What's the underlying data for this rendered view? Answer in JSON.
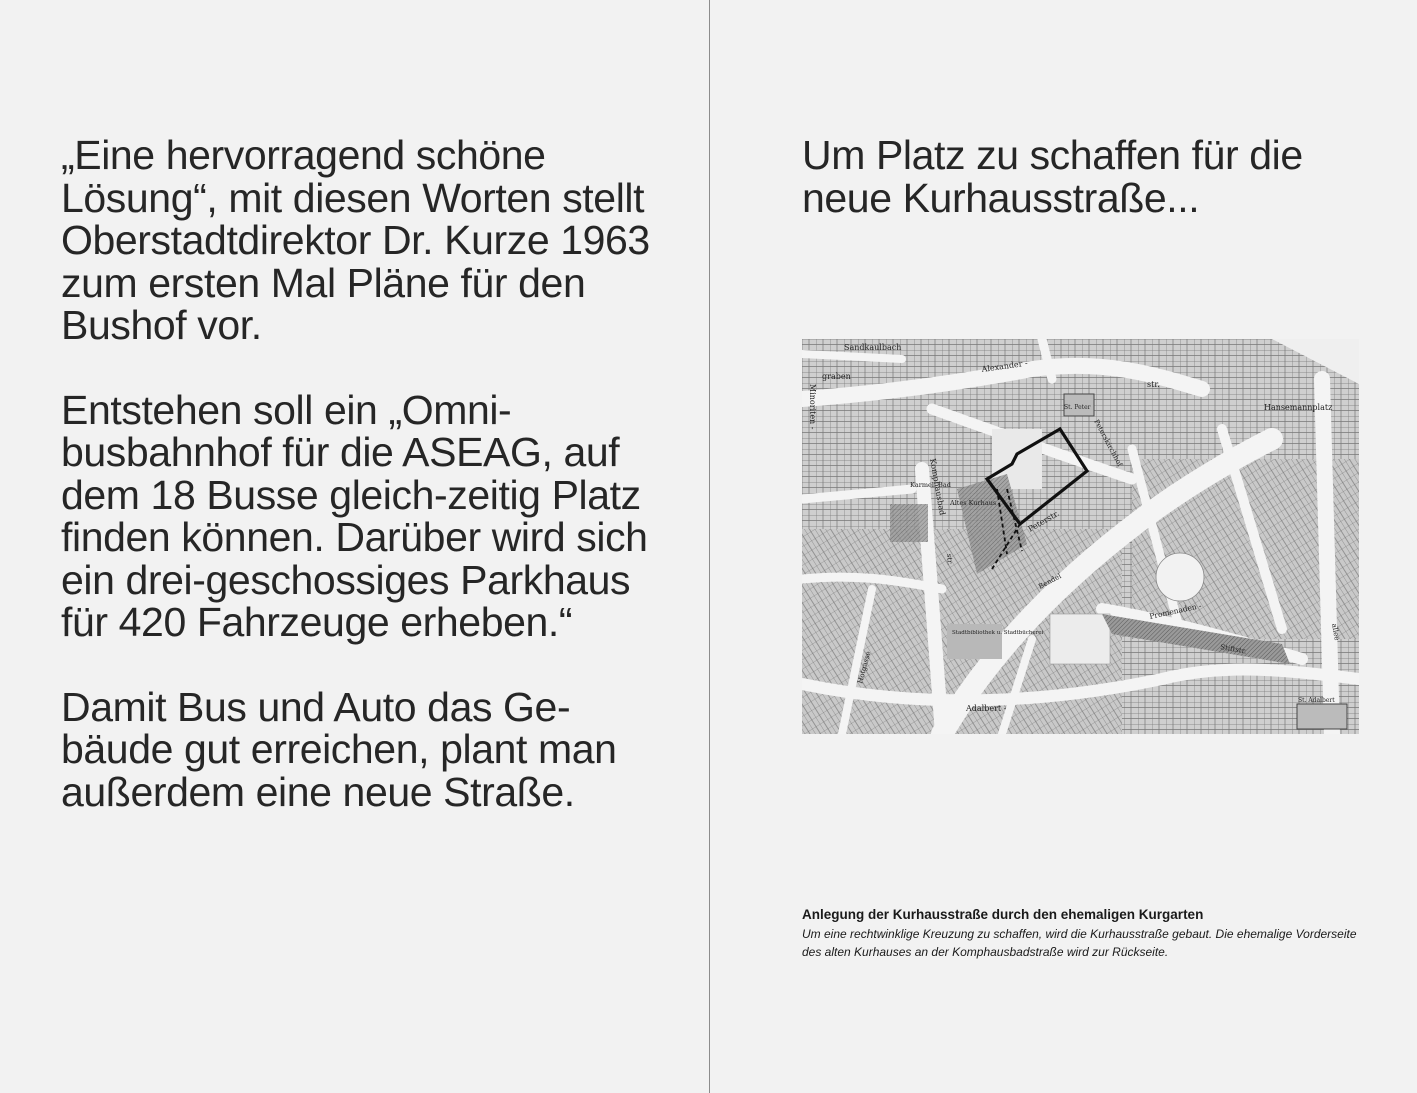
{
  "left": {
    "paragraphs": [
      "„Eine hervorragend schöne Lösung“, mit diesen Worten stellt Oberstadtdirektor Dr. Kurze 1963 zum ersten Mal Pläne für den Bushof vor.",
      "Entstehen soll ein „Omni-busbahnhof für die ASEAG, auf dem 18 Busse gleich-zeitig Platz finden können. Darüber wird sich ein drei-geschossiges Parkhaus für 420 Fahrzeuge erheben.“",
      "Damit Bus und Auto das Ge-bäude gut erreichen, plant man außerdem eine neue Straße."
    ]
  },
  "right": {
    "heading": "Um Platz zu schaffen für die neue Kurhausstraße...",
    "map": {
      "labels": {
        "sandkaulbach": "Sandkaulbach",
        "graben": "graben",
        "alexander": "Alexander -",
        "str1": "str.",
        "st_peter": "St. Peter",
        "hansemannplatz": "Hansemannplatz",
        "minoriten": "Minoriten -",
        "komphausbad": "Komphausbad",
        "karmel_bad": "Karmel. Bad",
        "altes_kurhaus": "Altes Kurhaus",
        "peterstr": "Peterstr.",
        "peterskirchhof": "Peterskirchhof",
        "bendel": "Bendel",
        "promenaden": "Promenaden -",
        "stiftstr": "Stiftstr.",
        "stadtbibliothek": "Stadtbibliothek u. Stadtbücherei",
        "hotgasse": "Hotgasse",
        "adalbert": "Adalbert -",
        "st_adalbert": "St. Adalbert",
        "allee": "allee",
        "str2": "str."
      }
    },
    "caption": {
      "title": "Anlegung der Kurhausstraße durch den ehemaligen Kurgarten",
      "body": "Um eine rechtwinklige Kreuzung zu schaffen, wird die Kurhausstraße gebaut. Die ehemalige Vorderseite des alten Kurhauses an der Komphausbadstraße wird zur Rückseite."
    }
  }
}
